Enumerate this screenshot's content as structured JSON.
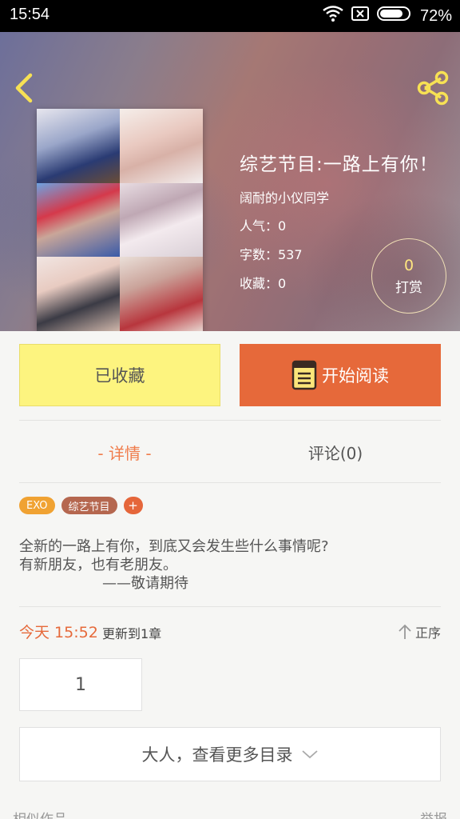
{
  "status_bar": {
    "time": "15:54",
    "battery": "72%"
  },
  "book": {
    "title": "综艺节目:一路上有你！",
    "author": "阔耐的小仪同学",
    "popularity": "人气：0",
    "word_count": "字数：537",
    "favorites": "收藏：0"
  },
  "reward": {
    "count": "0",
    "label": "打赏"
  },
  "actions": {
    "collected_label": "已收藏",
    "read_label": "开始阅读"
  },
  "tabs": {
    "details": "- 详情 -",
    "comments": "评论(0)"
  },
  "tags": [
    "EXO",
    "综艺节目"
  ],
  "tag_add": "+",
  "description": {
    "line1": "全新的一路上有你，到底又会发生些什么事情呢?",
    "line2": "有新朋友，也有老朋友。",
    "line3": "——敬请期待"
  },
  "update": {
    "time": "今天 15:52",
    "text": "更新到1章",
    "sort_label": "正序"
  },
  "chapter": {
    "number": "1"
  },
  "more_catalog": "大人，查看更多目录",
  "footer": {
    "similar": "相似作品",
    "report": "举报"
  },
  "colors": {
    "accent": "#e6693a",
    "collected_bg": "#fdf47f",
    "tab_active": "#f07c4b"
  }
}
